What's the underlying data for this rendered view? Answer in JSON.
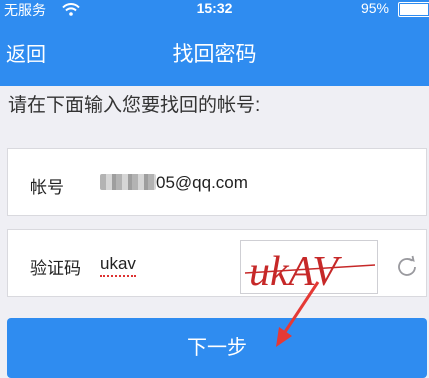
{
  "status_bar": {
    "carrier": "无服务",
    "time": "15:32",
    "battery": "95%",
    "battery_level": 0.95
  },
  "nav": {
    "back_label": "返回",
    "title": "找回密码"
  },
  "prompt": "请在下面输入您要找回的帐号:",
  "account": {
    "label": "帐号",
    "value_suffix": "05@qq.com"
  },
  "captcha": {
    "label": "验证码",
    "value": "ukav",
    "image_text": "ukAV"
  },
  "next_button": "下一步",
  "colors": {
    "accent": "#2f8cf0",
    "captcha_text": "#c62828",
    "annotation_arrow": "#e53935"
  },
  "icons": [
    "wifi-icon",
    "battery-icon",
    "refresh-icon"
  ]
}
